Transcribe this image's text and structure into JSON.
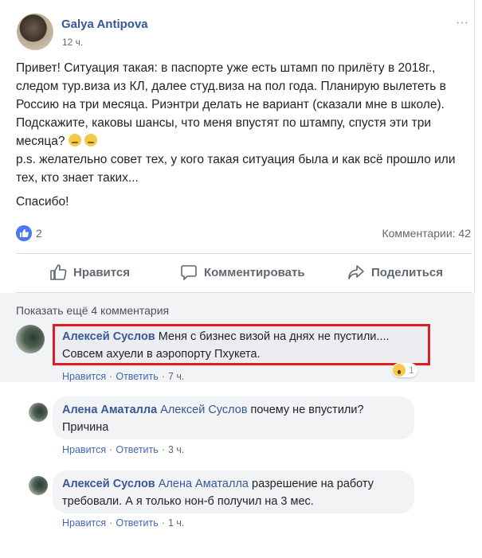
{
  "post": {
    "author": "Galya Antipova",
    "time": "12 ч.",
    "more": "···",
    "paragraphs": [
      "Привет! Ситуация такая: в паспорте уже есть штамп по прилёту в 2018г., следом тур.виза из КЛ, далее студ.виза на пол года. Планирую вылететь в Россию на три месяца. Риэнтри делать не вариант (сказали мне в школе). Подскажите, каковы шансы, что меня впустят по штампу, спустя эти три месяца?",
      "p.s. желательно совет тех, у кого такая ситуация была и как всё прошло или тех, кто знает таких..."
    ],
    "thanks": "Спасибо!",
    "likes": "2",
    "comments_count": "Комментарии: 42",
    "actions": {
      "like": "Нравится",
      "comment": "Комментировать",
      "share": "Поделиться"
    }
  },
  "show_more": "Показать ещё 4 комментария",
  "comments": [
    {
      "author": "Алексей Суслов",
      "text": " Меня с бизнес визой на днях не пустили.... Совсем ахуели в аэропорту Пхукета.",
      "like": "Нравится",
      "reply": "Ответить",
      "time": "7 ч.",
      "reaction_count": "1"
    },
    {
      "author": "Алена Аматалла",
      "mention": "Алексей Суслов",
      "text": " почему не впустили? Причина",
      "like": "Нравится",
      "reply": "Ответить",
      "time": "3 ч."
    },
    {
      "author": "Алексей Суслов",
      "mention": "Алена Аматалла",
      "text": " разрешение на работу требовали. А я только нон-б получил на 3 мес.",
      "like": "Нравится",
      "reply": "Ответить",
      "time": "1 ч."
    }
  ],
  "colors": {
    "link": "#385898",
    "highlight": "#e01b22",
    "like_badge": "#4a78f0"
  }
}
